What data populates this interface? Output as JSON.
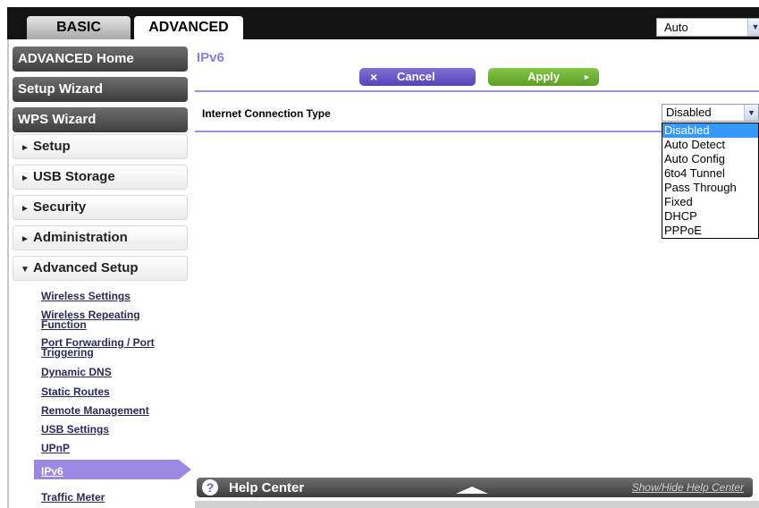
{
  "tabs": {
    "basic": "BASIC",
    "advanced": "ADVANCED"
  },
  "language_select": {
    "value": "Auto"
  },
  "sidebar": {
    "advanced_home": "ADVANCED Home",
    "setup_wizard": "Setup Wizard",
    "wps_wizard": "WPS Wizard",
    "setup": "Setup",
    "usb_storage": "USB Storage",
    "security": "Security",
    "administration": "Administration",
    "advanced_setup": "Advanced Setup",
    "sublinks": [
      "Wireless Settings",
      "Wireless Repeating Function",
      "Port Forwarding / Port Triggering",
      "Dynamic DNS",
      "Static Routes",
      "Remote Management",
      "USB Settings",
      "UPnP",
      "IPv6",
      "Traffic Meter"
    ]
  },
  "main": {
    "title": "IPv6",
    "cancel_label": "Cancel",
    "apply_label": "Apply",
    "field_label": "Internet Connection Type",
    "selected_value": "Disabled",
    "options": [
      "Disabled",
      "Auto Detect",
      "Auto Config",
      "6to4 Tunnel",
      "Pass Through",
      "Fixed",
      "DHCP",
      "PPPoE"
    ]
  },
  "help": {
    "title": "Help Center",
    "link": "Show/Hide Help Center",
    "icon_glyph": "?"
  },
  "glyphs": {
    "cancel": "×",
    "apply": "►",
    "collapsed": "►",
    "expanded": "▼",
    "dropdown": "▼"
  },
  "colors": {
    "accent_purple": "#8b7fe3",
    "apply_green": "#6fb134",
    "selection_blue": "#3399ff"
  }
}
